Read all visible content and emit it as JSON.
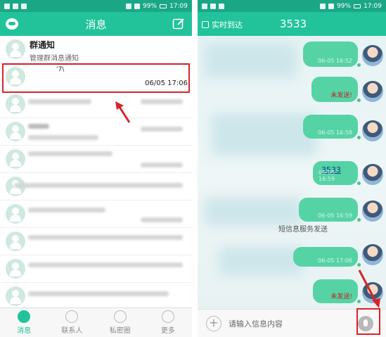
{
  "status_bar": {
    "battery": "99%",
    "time": "17:09"
  },
  "left": {
    "title": "消息",
    "conversations": [
      {
        "title": "群通知",
        "subtitle": "管理群消息通知",
        "time": ""
      },
      {
        "title": "'7\\",
        "subtitle": "",
        "time": "06/05 17:06"
      }
    ],
    "tabs": [
      {
        "label": "消息"
      },
      {
        "label": "联系人"
      },
      {
        "label": "私密圈"
      },
      {
        "label": "更多"
      }
    ]
  },
  "right": {
    "realtime_label": "实时到达",
    "phone_number": "3533",
    "messages": [
      {
        "time": "06-05 16:52",
        "status": ""
      },
      {
        "time": "",
        "status": "未发送!"
      },
      {
        "time": "06-05 16:58",
        "status": ""
      },
      {
        "link": "3533",
        "time": "06-05 16:59",
        "status": ""
      },
      {
        "time": "06-05 16:59",
        "status": ""
      },
      {
        "time": "06-05 17:06",
        "status": ""
      },
      {
        "time": "",
        "status": "未发送!"
      }
    ],
    "service_text": "短信息服务发送",
    "input_placeholder": "请输入信息内容"
  },
  "colors": {
    "accent": "#22c39a",
    "highlight_frame": "#d9232a",
    "bubble": "#56d3a5"
  }
}
